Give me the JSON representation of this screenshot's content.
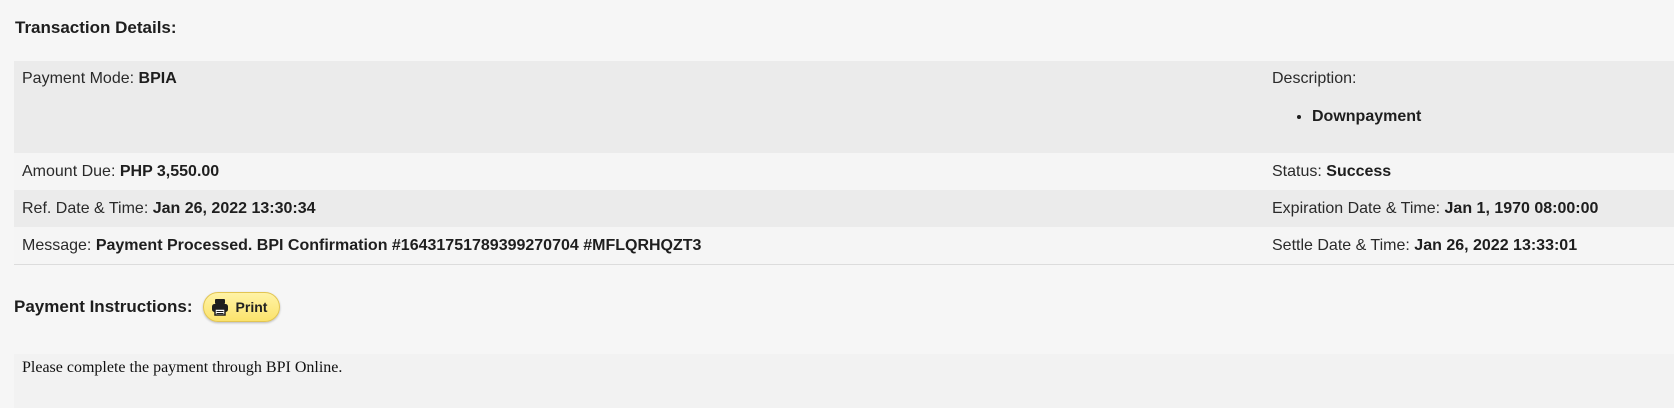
{
  "transaction": {
    "title": "Transaction Details:",
    "payment_mode": {
      "label": "Payment Mode:",
      "value": "BPIA"
    },
    "description": {
      "label": "Description:",
      "items": [
        "Downpayment"
      ]
    },
    "amount_due": {
      "label": "Amount Due:",
      "value": "PHP 3,550.00"
    },
    "status": {
      "label": "Status:",
      "value": "Success"
    },
    "ref_datetime": {
      "label": "Ref. Date & Time:",
      "value": "Jan 26, 2022 13:30:34"
    },
    "expiration_datetime": {
      "label": "Expiration Date & Time:",
      "value": "Jan 1, 1970 08:00:00"
    },
    "message": {
      "label": "Message:",
      "value": "Payment Processed. BPI Confirmation #16431751789399270704 #MFLQRHQZT3"
    },
    "settle_datetime": {
      "label": "Settle Date & Time:",
      "value": "Jan 26, 2022 13:33:01"
    }
  },
  "payment_instructions": {
    "title": "Payment Instructions:",
    "print_label": "Print",
    "print_icon": "printer-icon",
    "text": "Please complete the payment through BPI Online."
  }
}
